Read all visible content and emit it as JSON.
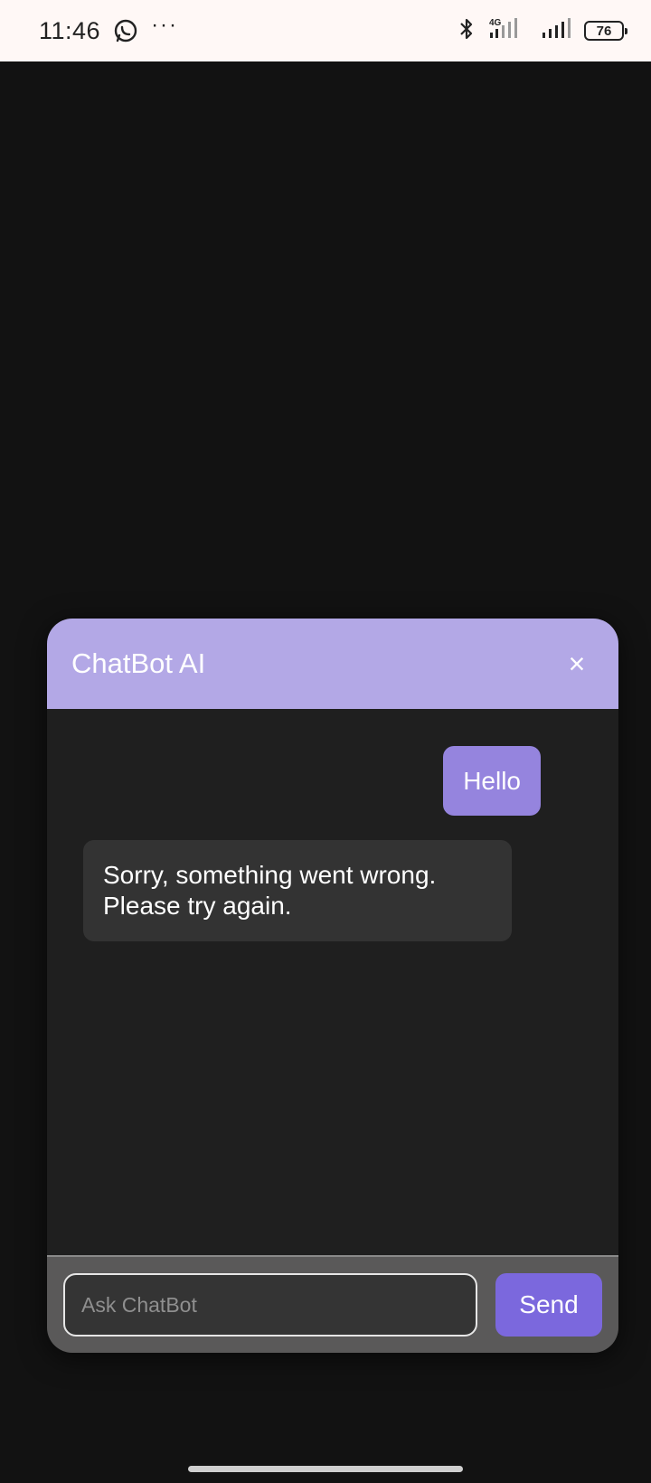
{
  "status_bar": {
    "time": "11:46",
    "more": "···",
    "network_label": "4G",
    "battery": "76",
    "icons": [
      "whatsapp-icon",
      "bluetooth-icon",
      "signal-4g-icon",
      "signal-icon",
      "battery-icon"
    ]
  },
  "chat": {
    "title": "ChatBot AI",
    "close_label": "×",
    "messages": [
      {
        "role": "user",
        "text": "Hello"
      },
      {
        "role": "bot",
        "text": "Sorry, something went wrong. Please try again."
      }
    ],
    "input": {
      "placeholder": "Ask ChatBot",
      "value": ""
    },
    "send_label": "Send"
  },
  "colors": {
    "header": "#b3a8e6",
    "user_bubble": "#9584de",
    "bot_bubble": "#333333",
    "send_button": "#7b68dd",
    "background": "#121212"
  }
}
